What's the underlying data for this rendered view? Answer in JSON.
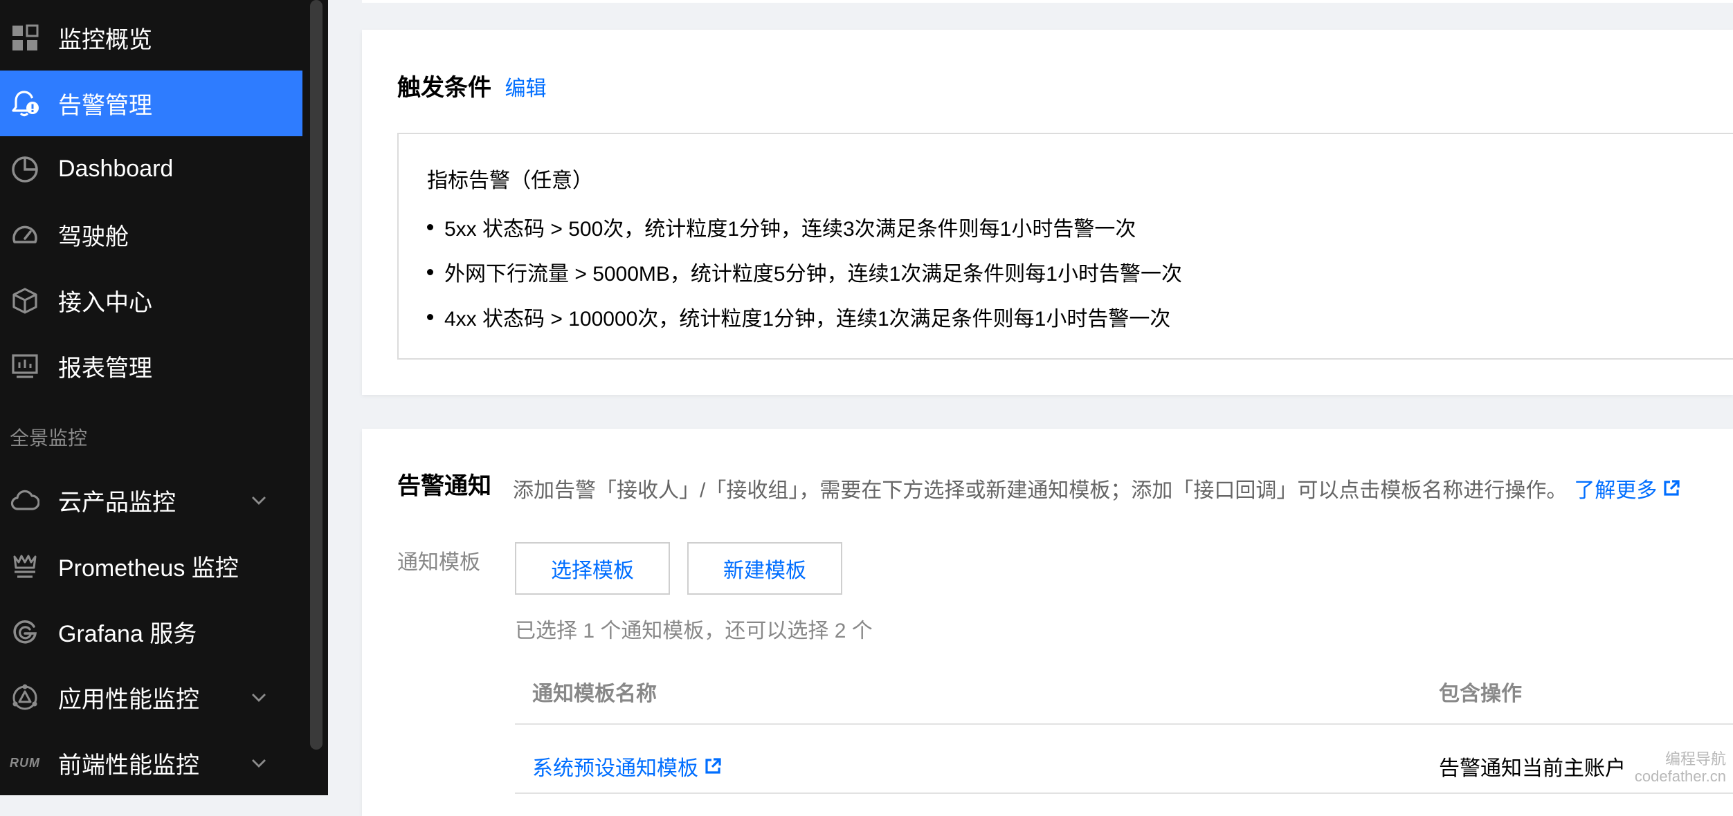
{
  "sidebar": {
    "items": [
      {
        "label": "监控概览",
        "icon": "grid-icon"
      },
      {
        "label": "告警管理",
        "icon": "alarm-bell-icon",
        "active": true
      },
      {
        "label": "Dashboard",
        "icon": "pie-chart-icon"
      },
      {
        "label": "驾驶舱",
        "icon": "speedometer-icon"
      },
      {
        "label": "接入中心",
        "icon": "cube-icon"
      },
      {
        "label": "报表管理",
        "icon": "report-monitor-icon"
      },
      {
        "label": "云产品监控",
        "icon": "cloud-icon",
        "expandable": true
      },
      {
        "label": "Prometheus 监控",
        "icon": "prometheus-icon"
      },
      {
        "label": "Grafana 服务",
        "icon": "grafana-icon"
      },
      {
        "label": "应用性能监控",
        "icon": "apm-icon",
        "expandable": true
      },
      {
        "label": "前端性能监控",
        "icon": "rum-icon",
        "icon_text": "RUM",
        "expandable": true
      }
    ],
    "section_label": "全景监控"
  },
  "trigger": {
    "title": "触发条件",
    "edit_label": "编辑",
    "heading": "指标告警（任意）",
    "rules": [
      "5xx 状态码 > 500次，统计粒度1分钟，连续3次满足条件则每1小时告警一次",
      "外网下行流量 > 5000MB，统计粒度5分钟，连续1次满足条件则每1小时告警一次",
      "4xx 状态码 > 100000次，统计粒度1分钟，连续1次满足条件则每1小时告警一次"
    ]
  },
  "notify": {
    "title": "告警通知",
    "description": "添加告警「接收人」/「接收组」，需要在下方选择或新建通知模板；添加「接口回调」可以点击模板名称进行操作。",
    "learn_more": "了解更多",
    "template_label": "通知模板",
    "select_button": "选择模板",
    "new_button": "新建模板",
    "hint": "已选择 1 个通知模板，还可以选择 2 个",
    "table": {
      "columns": [
        "通知模板名称",
        "包含操作"
      ],
      "rows": [
        {
          "name": "系统预设通知模板",
          "ops": "告警通知当前主账户"
        }
      ]
    }
  },
  "watermark": {
    "line1": "编程导航",
    "line2": "codefather.cn"
  },
  "colors": {
    "sidebar_bg": "#131313",
    "active_bg": "#2e7cff",
    "link": "#006eff",
    "page_bg": "#f0f2f5"
  }
}
